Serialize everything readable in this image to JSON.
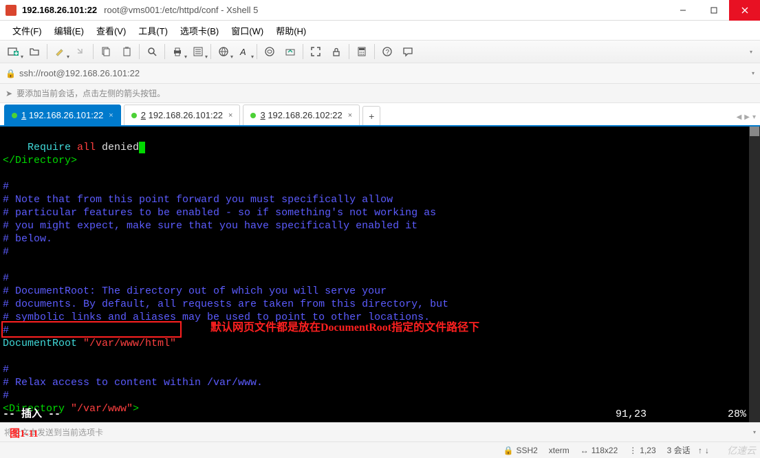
{
  "window": {
    "title": "192.168.26.101:22",
    "subtitle": "root@vms001:/etc/httpd/conf - Xshell 5"
  },
  "menu": {
    "file": "文件(F)",
    "edit": "编辑(E)",
    "view": "查看(V)",
    "tools": "工具(T)",
    "tabs": "选项卡(B)",
    "window": "窗口(W)",
    "help": "帮助(H)"
  },
  "address": {
    "url": "ssh://root@192.168.26.101:22"
  },
  "hint": {
    "text": "要添加当前会话，点击左侧的箭头按钮。"
  },
  "tabs": [
    {
      "index": "1",
      "label": "192.168.26.101:22",
      "active": true
    },
    {
      "index": "2",
      "label": "192.168.26.101:22",
      "active": false
    },
    {
      "index": "3",
      "label": "192.168.26.102:22",
      "active": false
    }
  ],
  "terminal": {
    "lines": {
      "l1a": "    Require ",
      "l1b": "all",
      "l1c": " denied",
      "l2": "</Directory>",
      "l3": "",
      "l4": "#",
      "l5": "# Note that from this point forward you must specifically allow",
      "l6": "# particular features to be enabled - so if something's not working as",
      "l7": "# you might expect, make sure that you have specifically enabled it",
      "l8": "# below.",
      "l9": "#",
      "l10": "",
      "l11": "#",
      "l12": "# DocumentRoot: The directory out of which you will serve your",
      "l13": "# documents. By default, all requests are taken from this directory, but",
      "l14": "# symbolic links and aliases may be used to point to other locations.",
      "l15": "#",
      "l16a": "DocumentRoot ",
      "l16b": "\"/var/www/html\"",
      "l17": "",
      "l18": "#",
      "l19": "# Relax access to content within /var/www.",
      "l20": "#",
      "l21a": "<Directory ",
      "l21b": "\"/var/www\"",
      "l21c": ">"
    },
    "mode": "-- 插入 --",
    "position": "91,23",
    "percent": "28%",
    "annotation": "默认网页文件都是放在DocumentRoot指定的文件路径下"
  },
  "bottom": {
    "placeholder": "将全文本发送到当前选项卡",
    "figure_label": "图1-11"
  },
  "status": {
    "ssh": "SSH2",
    "term": "xterm",
    "size": "118x22",
    "cursor": "1,23",
    "sessions": "3 会话",
    "watermark": "亿速云"
  },
  "icons": {
    "lock": "🔒",
    "arrow": "➤",
    "ssh_lock": "🔒",
    "size": "↔",
    "cursor": "⋮",
    "up": "↑",
    "down": "↓"
  }
}
